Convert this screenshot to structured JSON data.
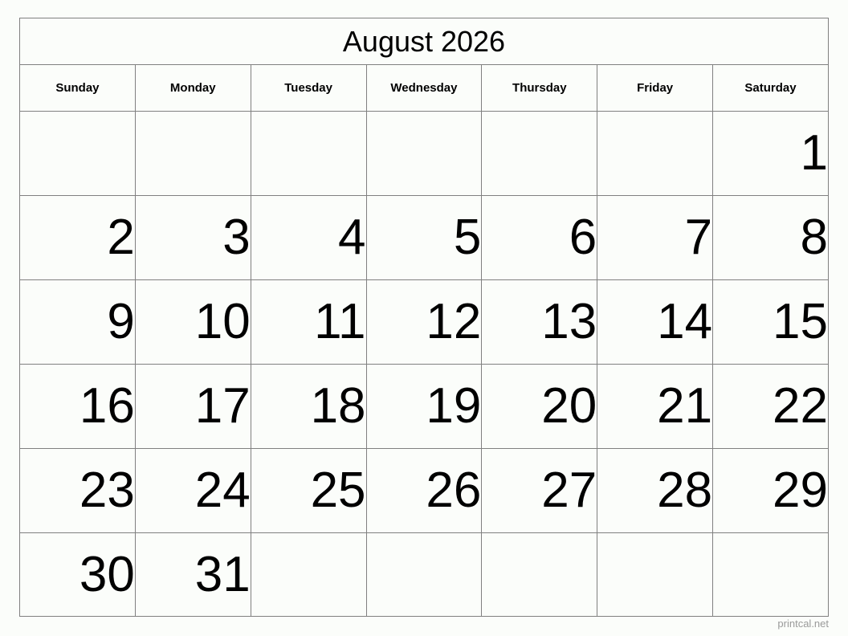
{
  "calendar": {
    "title": "August 2026",
    "month": "August",
    "year": "2026",
    "weekdays": [
      "Sunday",
      "Monday",
      "Tuesday",
      "Wednesday",
      "Thursday",
      "Friday",
      "Saturday"
    ],
    "weeks": [
      [
        "",
        "",
        "",
        "",
        "",
        "",
        "1"
      ],
      [
        "2",
        "3",
        "4",
        "5",
        "6",
        "7",
        "8"
      ],
      [
        "9",
        "10",
        "11",
        "12",
        "13",
        "14",
        "15"
      ],
      [
        "16",
        "17",
        "18",
        "19",
        "20",
        "21",
        "22"
      ],
      [
        "23",
        "24",
        "25",
        "26",
        "27",
        "28",
        "29"
      ],
      [
        "30",
        "31",
        "",
        "",
        "",
        "",
        ""
      ]
    ],
    "colors": {
      "background": "#fbfdfa",
      "border": "#808080",
      "text": "#000000",
      "watermark": "#9a9a9a"
    }
  },
  "footer": {
    "watermark": "printcal.net"
  }
}
